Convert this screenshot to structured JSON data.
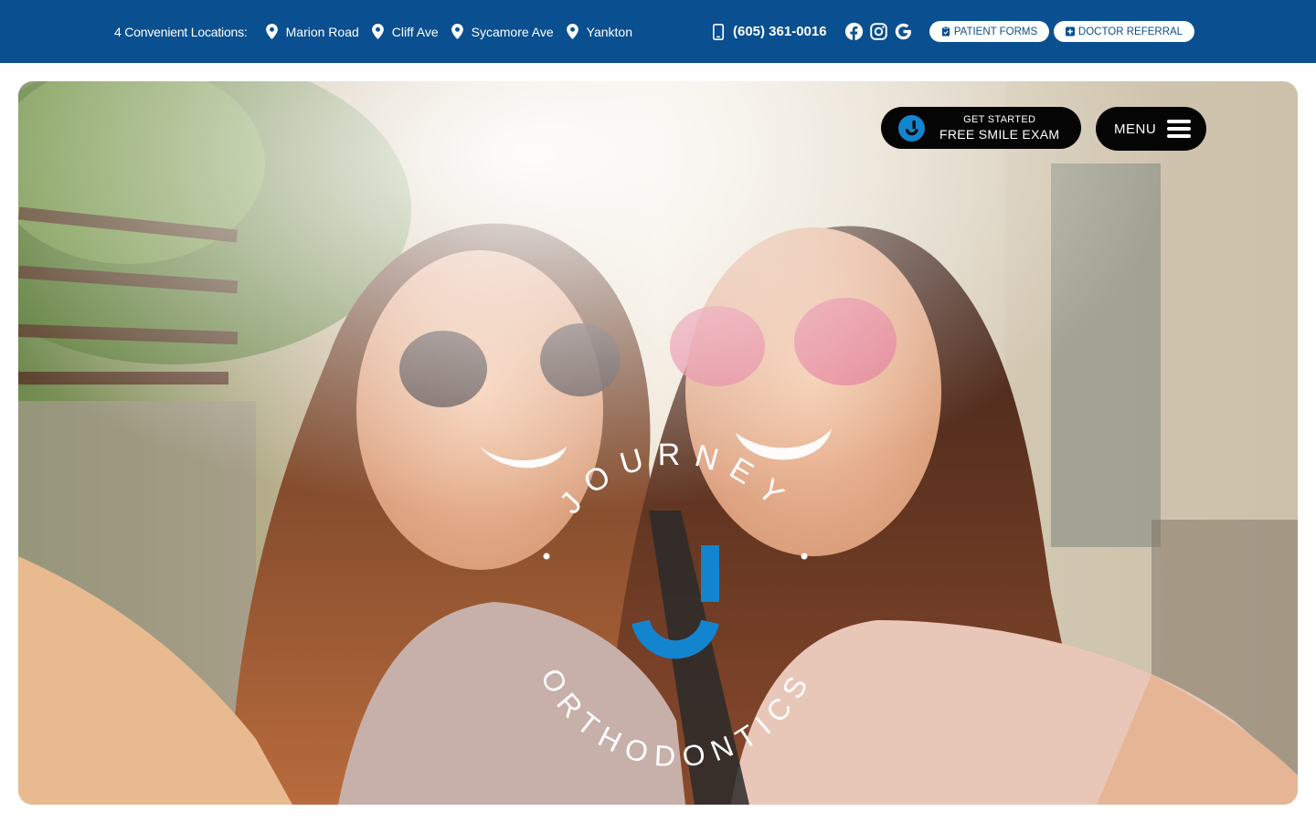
{
  "topbar": {
    "locations_intro": "4 Convenient Locations:",
    "locations": [
      {
        "label": "Marion Road",
        "icon": "map-pin-icon"
      },
      {
        "label": "Cliff Ave",
        "icon": "map-pin-icon"
      },
      {
        "label": "Sycamore Ave",
        "icon": "map-pin-icon"
      },
      {
        "label": "Yankton",
        "icon": "map-pin-icon"
      }
    ],
    "phone": "(605) 361-0016",
    "socials": [
      "facebook-icon",
      "instagram-icon",
      "google-icon"
    ],
    "patient_forms_label": "PATIENT FORMS",
    "doctor_referral_label": "DOCTOR REFERRAL"
  },
  "hero": {
    "cta_small": "GET STARTED",
    "cta_big": "FREE SMILE EXAM",
    "menu_label": "MENU",
    "logo_top_text": "JOURNEY",
    "logo_bottom_text": "ORTHODONTICS"
  },
  "colors": {
    "brand_blue": "#0a4f8f",
    "logo_blue": "#1385cf",
    "button_black": "#050505"
  }
}
